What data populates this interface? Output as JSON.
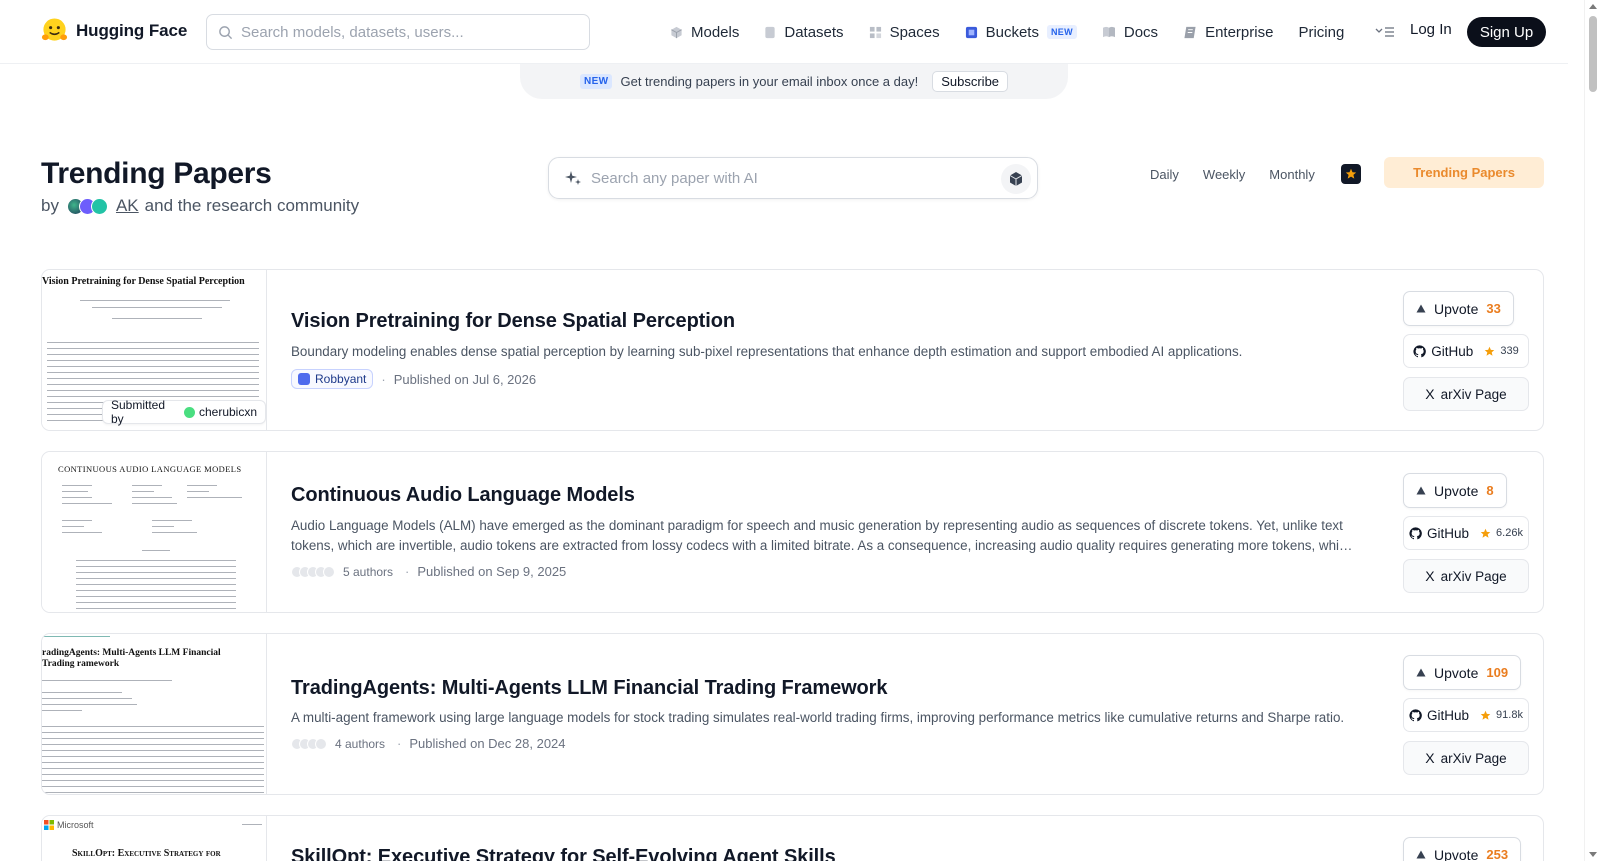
{
  "nav": {
    "brand": "Hugging Face",
    "search_placeholder": "Search models, datasets, users...",
    "links": [
      {
        "label": "Models",
        "icon": "cube-icon"
      },
      {
        "label": "Datasets",
        "icon": "database-icon"
      },
      {
        "label": "Spaces",
        "icon": "grid-icon"
      },
      {
        "label": "Buckets",
        "icon": "bucket-icon",
        "badge": "NEW"
      },
      {
        "label": "Docs",
        "icon": "book-icon"
      },
      {
        "label": "Enterprise",
        "icon": "enterprise-icon"
      },
      {
        "label": "Pricing"
      }
    ],
    "login": "Log In",
    "signup": "Sign Up"
  },
  "banner": {
    "badge": "NEW",
    "message": "Get trending papers in your email inbox once a day!",
    "button": "Subscribe"
  },
  "header": {
    "title": "Trending Papers",
    "by": "by",
    "author": "AK",
    "community": "and the research community",
    "search_placeholder": "Search any paper with AI",
    "tabs": [
      "Daily",
      "Weekly",
      "Monthly"
    ],
    "trending_button": "Trending Papers"
  },
  "papers": [
    {
      "title": "Vision Pretraining for Dense Spatial Perception",
      "summary": "Boundary modeling enables dense spatial perception by learning sub-pixel representations that enhance depth estimation and support embodied AI applications.",
      "org": "Robbyant",
      "published": "Published on Jul 6, 2026",
      "submitted_label": "Submitted by",
      "submitter": "cherubicxn",
      "upvote_label": "Upvote",
      "upvotes": "33",
      "github_label": "GitHub",
      "stars": "339",
      "arxiv_label": "arXiv Page",
      "thumb_title": "Vision Pretraining for Dense Spatial Perception"
    },
    {
      "title": "Continuous Audio Language Models",
      "summary": "Audio Language Models (ALM) have emerged as the dominant paradigm for speech and music generation by representing audio as sequences of discrete tokens. Yet, unlike text tokens, which are invertible, audio tokens are extracted from lossy codecs with a limited bitrate. As a consequence, increasing audio quality requires generating more tokens, which imposes a trade-off between quality and computational cost.",
      "authors": "5 authors",
      "published": "Published on Sep 9, 2025",
      "upvote_label": "Upvote",
      "upvotes": "8",
      "github_label": "GitHub",
      "stars": "6.26k",
      "arxiv_label": "arXiv Page",
      "thumb_title": "Continuous Audio Language Models"
    },
    {
      "title": "TradingAgents: Multi-Agents LLM Financial Trading Framework",
      "summary": "A multi-agent framework using large language models for stock trading simulates real-world trading firms, improving performance metrics like cumulative returns and Sharpe ratio.",
      "authors": "4 authors",
      "published": "Published on Dec 28, 2024",
      "upvote_label": "Upvote",
      "upvotes": "109",
      "github_label": "GitHub",
      "stars": "91.8k",
      "arxiv_label": "arXiv Page",
      "thumb_title": "radingAgents: Multi-Agents LLM Financial Trading ramework"
    },
    {
      "title": "SkillOpt: Executive Strategy for Self-Evolving Agent Skills",
      "upvote_label": "Upvote",
      "upvotes": "253",
      "thumb_brand": "Microsoft",
      "thumb_title": "SkillOpt: Executive Strategy for"
    }
  ],
  "colors": {
    "accent_orange": "#ea7d1f",
    "trending_bg": "#ffedd5",
    "signup_bg": "#0b0f1a",
    "new_badge": "#2563eb"
  }
}
